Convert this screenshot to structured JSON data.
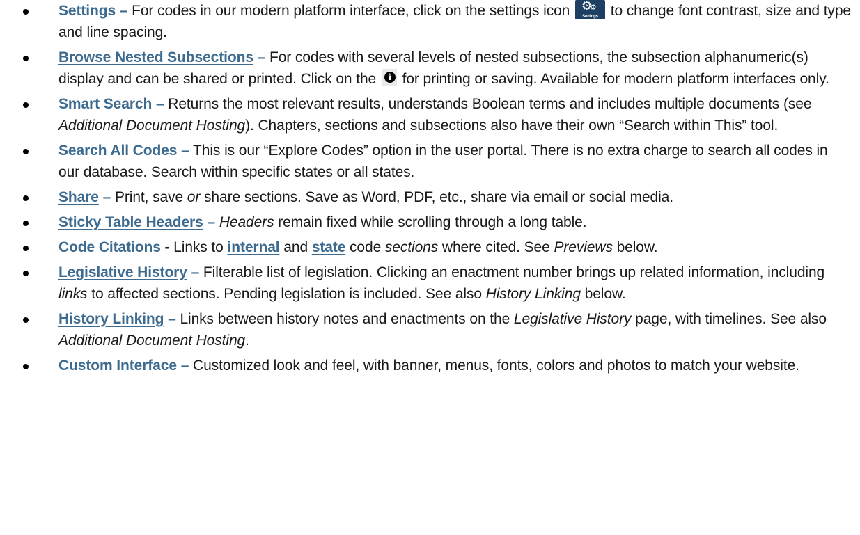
{
  "items": [
    {
      "term": "Settings",
      "dash": "–",
      "text_a": " For codes in our modern platform interface, click on the settings icon ",
      "icon_caption": "Settings",
      "text_b": " to change font contrast, size and type and line spacing."
    },
    {
      "term": "Browse Nested Subsections",
      "dash": "–",
      "text_a": " For codes with several levels of nested subsections, the subsection alphanumeric(s) display and can be shared or printed. Click on the ",
      "icon_glyph": "i",
      "text_b": " for printing or saving. Available for modern platform interfaces only."
    },
    {
      "term": "Smart Search",
      "dash": "–",
      "text_a": " Returns the most relevant results, understands Boolean terms and includes multiple documents (see ",
      "em_a": "Additional Document Hosting",
      "text_b": "). Chapters, sections and subsections also have their own “Search within This” tool."
    },
    {
      "term": "Search All Codes",
      "dash": "–",
      "text_a": " This is our “Explore Codes” option in the user portal. There is no extra charge to search all codes in our database. Search within specific states or all states."
    },
    {
      "term": "Share",
      "dash": "–",
      "text_a": " Print, save ",
      "em_a": "or",
      "text_b": " share sections. Save as Word, PDF, etc., share via email or social media."
    },
    {
      "term": "Sticky Table Headers",
      "dash": "–",
      "em_a": "Headers",
      "text_a": " remain fixed while scrolling through a long table."
    },
    {
      "term": "Code Citations",
      "dash": "-",
      "text_a": " Links to ",
      "link_a": "internal",
      "text_b": " and ",
      "link_b": "state",
      "text_c": " code ",
      "em_a": "sections",
      "text_d": " where cited. See ",
      "em_b": "Previews",
      "text_e": " below."
    },
    {
      "term": "Legislative History",
      "dash": "–",
      "text_a": " Filterable list of legislation. Clicking an enactment number brings up related information, including ",
      "em_a": "links",
      "text_b": " to affected sections. Pending legislation is included. See also ",
      "em_b": "History Linking",
      "text_c": " below."
    },
    {
      "term": "History Linking",
      "dash": "–",
      "text_a": " Links between history notes and enactments on the ",
      "em_a": "Legislative History",
      "text_b": " page, with timelines. See also ",
      "em_b": "Additional Document Hosting",
      "text_c": "."
    },
    {
      "term": "Custom Interface",
      "dash": "–",
      "text_a": " Customized look and feel, with banner, menus, fonts, colors and photos to match your website."
    }
  ]
}
